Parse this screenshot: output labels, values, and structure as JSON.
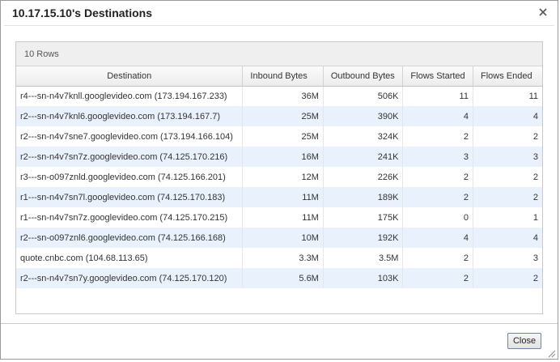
{
  "dialog": {
    "title": "10.17.15.10's Destinations",
    "close_icon": "close-icon",
    "close_button_label": "Close"
  },
  "grid": {
    "row_count_label": "10 Rows",
    "columns": [
      "Destination",
      "Inbound Bytes",
      "Outbound Bytes",
      "Flows Started",
      "Flows Ended"
    ],
    "rows": [
      {
        "destination": "r4---sn-n4v7knll.googlevideo.com (173.194.167.233)",
        "inbound": "36M",
        "outbound": "506K",
        "started": "11",
        "ended": "11"
      },
      {
        "destination": "r2---sn-n4v7knl6.googlevideo.com (173.194.167.7)",
        "inbound": "25M",
        "outbound": "390K",
        "started": "4",
        "ended": "4"
      },
      {
        "destination": "r2---sn-n4v7sne7.googlevideo.com (173.194.166.104)",
        "inbound": "25M",
        "outbound": "324K",
        "started": "2",
        "ended": "2"
      },
      {
        "destination": "r2---sn-n4v7sn7z.googlevideo.com (74.125.170.216)",
        "inbound": "16M",
        "outbound": "241K",
        "started": "3",
        "ended": "3"
      },
      {
        "destination": "r3---sn-o097znld.googlevideo.com (74.125.166.201)",
        "inbound": "12M",
        "outbound": "226K",
        "started": "2",
        "ended": "2"
      },
      {
        "destination": "r1---sn-n4v7sn7l.googlevideo.com (74.125.170.183)",
        "inbound": "11M",
        "outbound": "189K",
        "started": "2",
        "ended": "2"
      },
      {
        "destination": "r1---sn-n4v7sn7z.googlevideo.com (74.125.170.215)",
        "inbound": "11M",
        "outbound": "175K",
        "started": "0",
        "ended": "1"
      },
      {
        "destination": "r2---sn-o097znl6.googlevideo.com (74.125.166.168)",
        "inbound": "10M",
        "outbound": "192K",
        "started": "4",
        "ended": "4"
      },
      {
        "destination": "quote.cnbc.com (104.68.113.65)",
        "inbound": "3.3M",
        "outbound": "3.5M",
        "started": "2",
        "ended": "3"
      },
      {
        "destination": "r2---sn-n4v7sn7y.googlevideo.com (74.125.170.120)",
        "inbound": "5.6M",
        "outbound": "103K",
        "started": "2",
        "ended": "2"
      }
    ]
  },
  "icons": {
    "resize_grip": "resize-grip-icon"
  }
}
